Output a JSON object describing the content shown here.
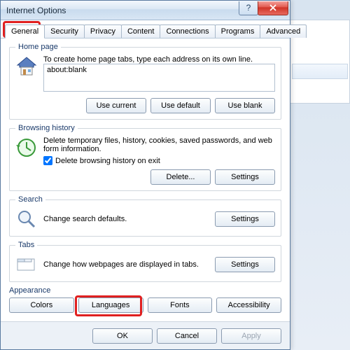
{
  "title": "Internet Options",
  "tabs": [
    "General",
    "Security",
    "Privacy",
    "Content",
    "Connections",
    "Programs",
    "Advanced"
  ],
  "homepage": {
    "legend": "Home page",
    "hint": "To create home page tabs, type each address on its own line.",
    "value": "about:blank",
    "use_current": "Use current",
    "use_default": "Use default",
    "use_blank": "Use blank"
  },
  "history": {
    "legend": "Browsing history",
    "hint": "Delete temporary files, history, cookies, saved passwords, and web form information.",
    "checkbox": "Delete browsing history on exit",
    "delete": "Delete...",
    "settings": "Settings"
  },
  "search": {
    "legend": "Search",
    "hint": "Change search defaults.",
    "settings": "Settings"
  },
  "tabs_section": {
    "legend": "Tabs",
    "hint": "Change how webpages are displayed in tabs.",
    "settings": "Settings"
  },
  "appearance": {
    "legend": "Appearance",
    "colors": "Colors",
    "languages": "Languages",
    "fonts": "Fonts",
    "accessibility": "Accessibility"
  },
  "bottom": {
    "ok": "OK",
    "cancel": "Cancel",
    "apply": "Apply"
  }
}
